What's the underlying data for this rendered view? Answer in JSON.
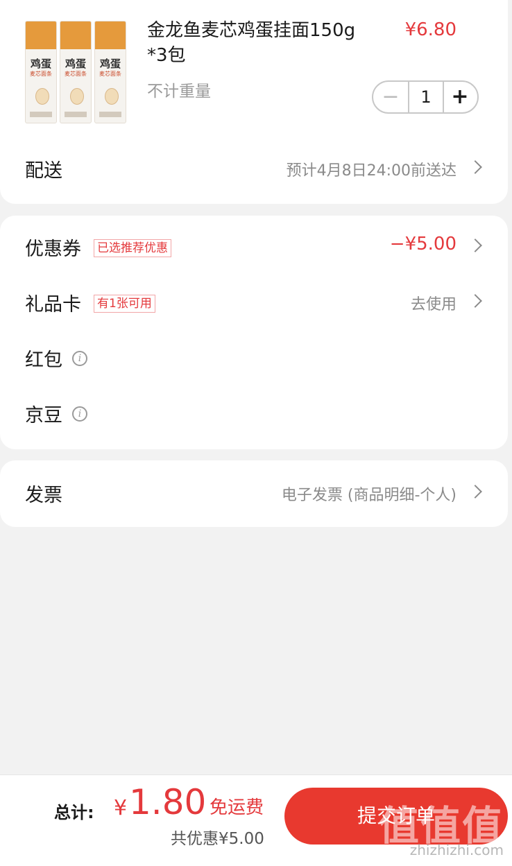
{
  "product": {
    "title": "金龙鱼麦芯鸡蛋挂面150g*3包",
    "price": "¥6.80",
    "subtitle": "不计重量",
    "quantity": "1",
    "minus": "−",
    "plus": "+",
    "pack_text": "鸡蛋",
    "pack_sub": "麦芯面条"
  },
  "delivery": {
    "label": "配送",
    "value": "预计4月8日24:00前送达"
  },
  "coupon": {
    "label": "优惠券",
    "tag": "已选推荐优惠",
    "value": "−¥5.00"
  },
  "giftcard": {
    "label": "礼品卡",
    "tag": "有1张可用",
    "value": "去使用"
  },
  "redpacket": {
    "label": "红包",
    "info": "i"
  },
  "jingdou": {
    "label": "京豆",
    "info": "i"
  },
  "invoice": {
    "label": "发票",
    "value": "电子发票 (商品明细-个人)"
  },
  "footer": {
    "total_label": "总计:",
    "currency": "¥",
    "total_amount": "1.80",
    "free_shipping": "免运费",
    "saved": "共优惠¥5.00",
    "submit": "提交订单"
  },
  "watermark": {
    "glyphs": "值值值",
    "domain": "zhizhizhi.com"
  },
  "colors": {
    "accent": "#e4393c",
    "button": "#e8392f",
    "background": "#f2f2f2"
  }
}
